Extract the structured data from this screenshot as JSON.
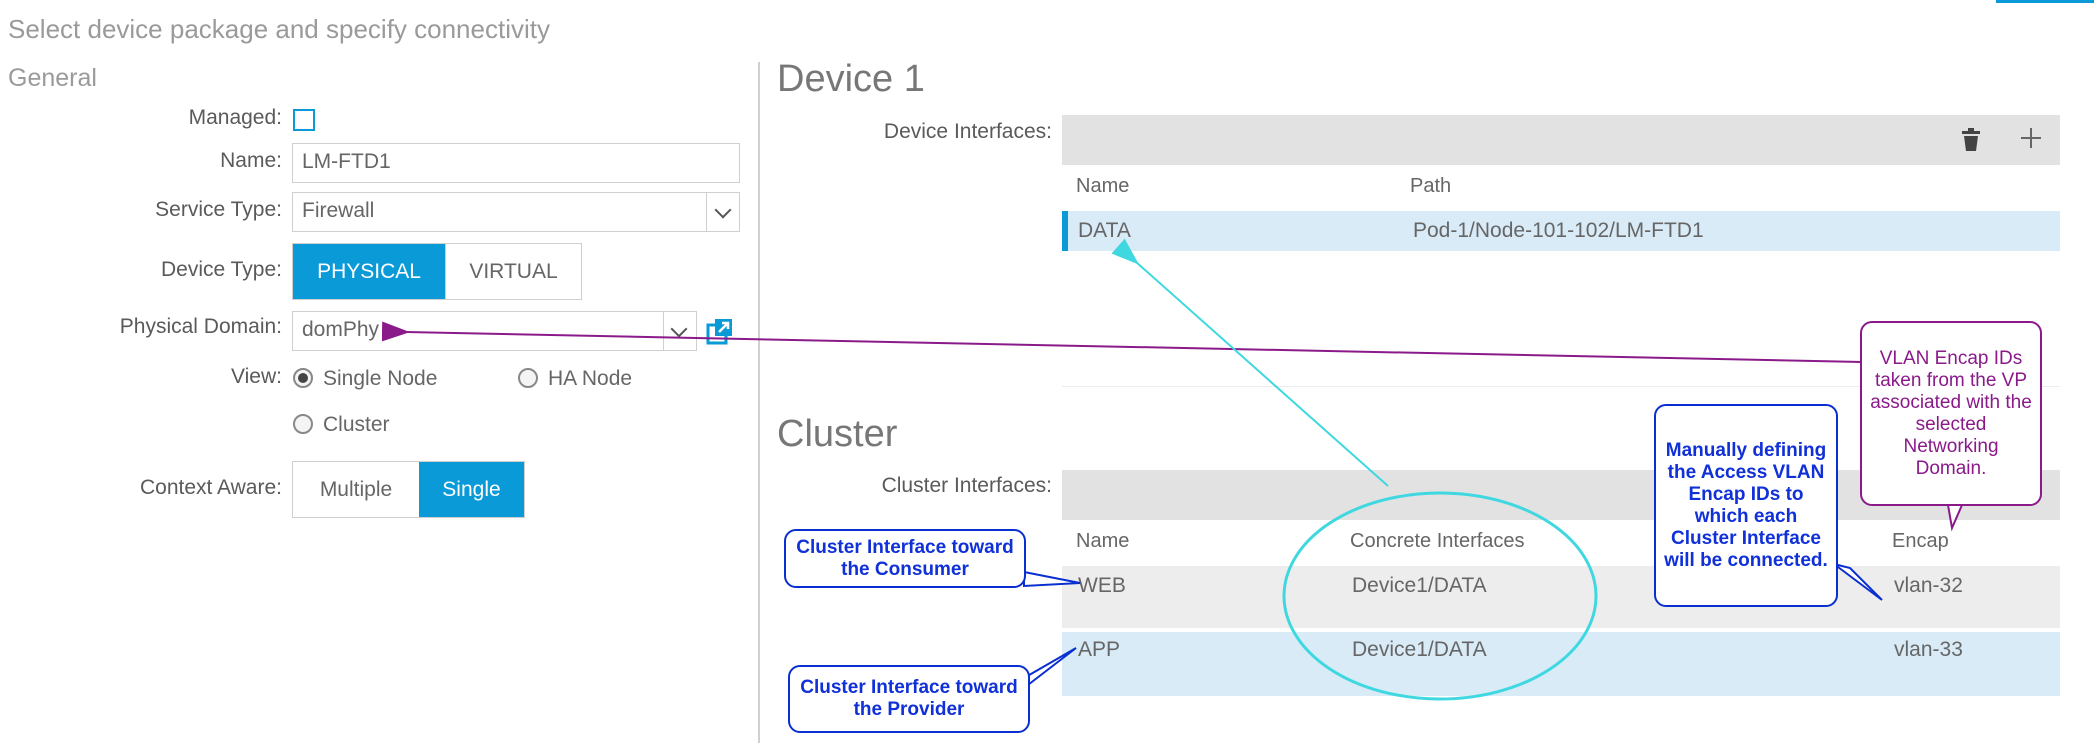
{
  "page": {
    "title": "Select device package and specify connectivity"
  },
  "general": {
    "heading": "General",
    "managed_label": "Managed:",
    "name_label": "Name:",
    "name_value": "LM-FTD1",
    "service_type_label": "Service Type:",
    "service_type_value": "Firewall",
    "device_type_label": "Device Type:",
    "device_type_options": [
      "PHYSICAL",
      "VIRTUAL"
    ],
    "physical_domain_label": "Physical Domain:",
    "physical_domain_value": "domPhy",
    "view_label": "View:",
    "view_options": [
      "Single Node",
      "HA Node",
      "Cluster"
    ],
    "view_selected": "Single Node",
    "context_aware_label": "Context Aware:",
    "context_options": [
      "Multiple",
      "Single"
    ],
    "context_selected": "Single"
  },
  "device": {
    "title": "Device 1",
    "interfaces_label": "Device Interfaces:",
    "columns": [
      "Name",
      "Path"
    ],
    "rows": [
      {
        "name": "DATA",
        "path": "Pod-1/Node-101-102/LM-FTD1"
      }
    ]
  },
  "cluster": {
    "title": "Cluster",
    "interfaces_label": "Cluster Interfaces:",
    "columns": [
      "Name",
      "Concrete Interfaces",
      "Encap"
    ],
    "rows": [
      {
        "name": "WEB",
        "concrete": "Device1/DATA",
        "encap": "vlan-32"
      },
      {
        "name": "APP",
        "concrete": "Device1/DATA",
        "encap": "vlan-33"
      }
    ]
  },
  "icons": [
    "checkbox-icon",
    "chevron-down-icon",
    "external-link-icon",
    "trash-icon",
    "plus-icon"
  ],
  "colors": {
    "accent": "#0a9ad8",
    "callout_blue": "#0a2fd0",
    "callout_purple": "#8a1a8a",
    "highlight_ring": "#40d8e0"
  },
  "callouts": {
    "consumer": "Cluster Interface toward the Consumer",
    "provider": "Cluster Interface toward the Provider",
    "manual": "Manually defining the Access VLAN Encap IDs to which each Cluster Interface will be connected.",
    "vlan": "VLAN Encap IDs taken from the VP associated with the selected Networking Domain."
  }
}
